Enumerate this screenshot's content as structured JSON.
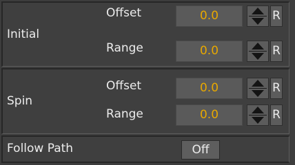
{
  "initial": {
    "label": "Initial",
    "offset": {
      "label": "Offset",
      "value": "0.0"
    },
    "range": {
      "label": "Range",
      "value": "0.0"
    }
  },
  "spin": {
    "label": "Spin",
    "offset": {
      "label": "Offset",
      "value": "0.0"
    },
    "range": {
      "label": "Range",
      "value": "0.0"
    }
  },
  "follow_path": {
    "label": "Follow Path",
    "toggle_value": "Off"
  },
  "reset_label": "R",
  "colors": {
    "value_text": "#e8a800",
    "panel_bg": "#3f3f3f",
    "field_bg": "#5a5a5a"
  }
}
